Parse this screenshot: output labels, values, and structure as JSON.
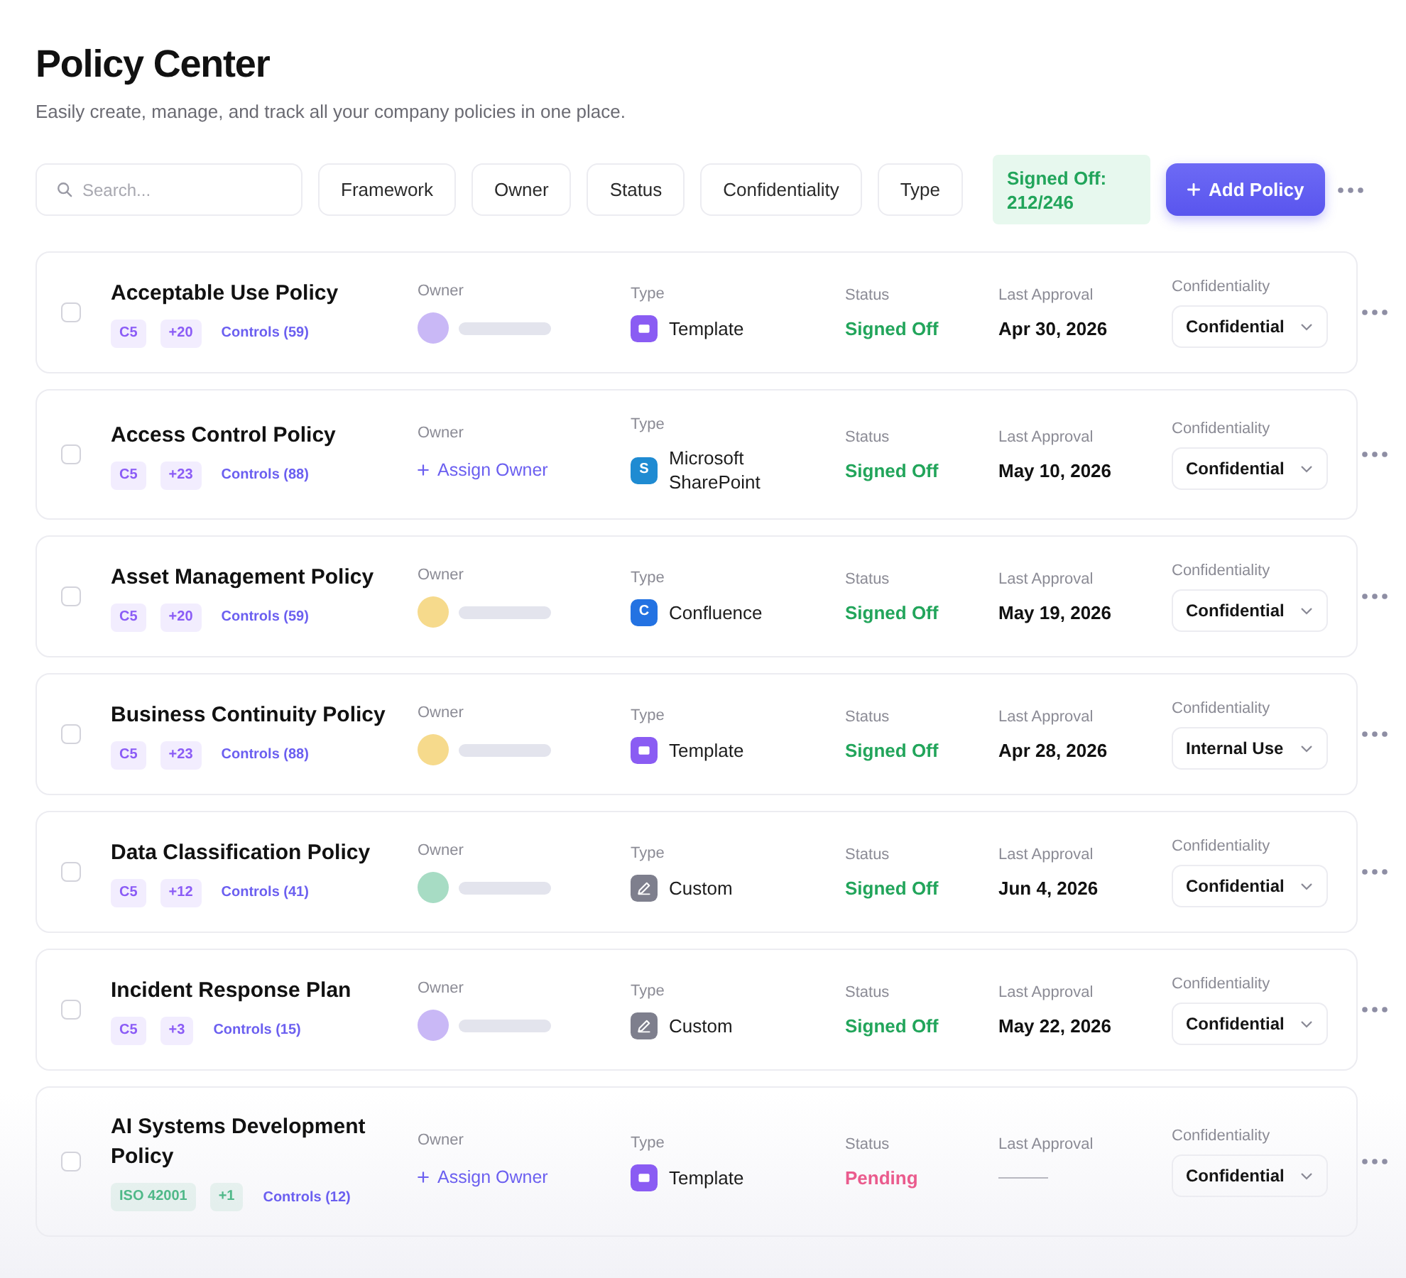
{
  "header": {
    "title": "Policy Center",
    "subtitle": "Easily create, manage, and track all your company policies in one place."
  },
  "toolbar": {
    "search": {
      "placeholder": "Search..."
    },
    "filters": [
      "Framework",
      "Owner",
      "Status",
      "Confidentiality",
      "Type"
    ],
    "summary": {
      "label": "Signed Off:",
      "value": "212/246"
    },
    "add_button": "Add Policy"
  },
  "policies": [
    {
      "name": "Acceptable Use Policy",
      "checked": false,
      "tags": [
        {
          "label": "C5",
          "color": "#8b5cf6"
        },
        {
          "label": "+20",
          "color": "#8b5cf6"
        }
      ],
      "controls": "Controls (59)",
      "owner_label": "Owner",
      "owner": {
        "kind": "avatar",
        "color": "#c9b8f6"
      },
      "type_label": "Type",
      "type": {
        "kind": "template",
        "label": "Template"
      },
      "status_label": "Status",
      "status": {
        "kind": "signed_off",
        "label": "Signed Off"
      },
      "approval_label": "Last Approval",
      "approval": {
        "kind": "date",
        "text": "Apr 30, 2026"
      },
      "confidentiality_label": "Confidentiality",
      "confidentiality": "Confidential"
    },
    {
      "name": "Access Control Policy",
      "checked": false,
      "tags": [
        {
          "label": "C5",
          "color": "#8b5cf6"
        },
        {
          "label": "+23",
          "color": "#8b5cf6"
        }
      ],
      "controls": "Controls (88)",
      "owner_label": "Owner",
      "owner": {
        "kind": "assign",
        "label": "Assign Owner"
      },
      "type_label": "Type",
      "type": {
        "kind": "sharepoint",
        "icon_text": "S",
        "label": "Microsoft SharePoint"
      },
      "status_label": "Status",
      "status": {
        "kind": "signed_off",
        "label": "Signed Off"
      },
      "approval_label": "Last Approval",
      "approval": {
        "kind": "date",
        "text": "May 10, 2026"
      },
      "confidentiality_label": "Confidentiality",
      "confidentiality": "Confidential"
    },
    {
      "name": "Asset Management Policy",
      "checked": false,
      "tags": [
        {
          "label": "C5",
          "color": "#8b5cf6"
        },
        {
          "label": "+20",
          "color": "#8b5cf6"
        }
      ],
      "controls": "Controls (59)",
      "owner_label": "Owner",
      "owner": {
        "kind": "avatar",
        "color": "#f6da8c"
      },
      "type_label": "Type",
      "type": {
        "kind": "confluence",
        "icon_text": "C",
        "label": "Confluence"
      },
      "status_label": "Status",
      "status": {
        "kind": "signed_off",
        "label": "Signed Off"
      },
      "approval_label": "Last Approval",
      "approval": {
        "kind": "date",
        "text": "May 19, 2026"
      },
      "confidentiality_label": "Confidentiality",
      "confidentiality": "Confidential"
    },
    {
      "name": "Business Continuity Policy",
      "checked": false,
      "tags": [
        {
          "label": "C5",
          "color": "#8b5cf6"
        },
        {
          "label": "+23",
          "color": "#8b5cf6"
        }
      ],
      "controls": "Controls (88)",
      "owner_label": "Owner",
      "owner": {
        "kind": "avatar",
        "color": "#f6da8c"
      },
      "type_label": "Type",
      "type": {
        "kind": "template",
        "label": "Template"
      },
      "status_label": "Status",
      "status": {
        "kind": "signed_off",
        "label": "Signed Off"
      },
      "approval_label": "Last Approval",
      "approval": {
        "kind": "date",
        "text": "Apr 28, 2026"
      },
      "confidentiality_label": "Confidentiality",
      "confidentiality": "Internal Use"
    },
    {
      "name": "Data Classification Policy",
      "checked": false,
      "tags": [
        {
          "label": "C5",
          "color": "#8b5cf6"
        },
        {
          "label": "+12",
          "color": "#8b5cf6"
        }
      ],
      "controls": "Controls (41)",
      "owner_label": "Owner",
      "owner": {
        "kind": "avatar",
        "color": "#a7dcc4"
      },
      "type_label": "Type",
      "type": {
        "kind": "custom",
        "label": "Custom"
      },
      "status_label": "Status",
      "status": {
        "kind": "signed_off",
        "label": "Signed Off"
      },
      "approval_label": "Last Approval",
      "approval": {
        "kind": "date",
        "text": "Jun 4, 2026"
      },
      "confidentiality_label": "Confidentiality",
      "confidentiality": "Confidential"
    },
    {
      "name": "Incident Response Plan",
      "checked": false,
      "tags": [
        {
          "label": "C5",
          "color": "#8b5cf6"
        },
        {
          "label": "+3",
          "color": "#8b5cf6"
        }
      ],
      "controls": "Controls (15)",
      "owner_label": "Owner",
      "owner": {
        "kind": "avatar",
        "color": "#c9b8f6"
      },
      "type_label": "Type",
      "type": {
        "kind": "custom",
        "label": "Custom"
      },
      "status_label": "Status",
      "status": {
        "kind": "signed_off",
        "label": "Signed Off"
      },
      "approval_label": "Last Approval",
      "approval": {
        "kind": "date",
        "text": "May 22, 2026"
      },
      "confidentiality_label": "Confidentiality",
      "confidentiality": "Confidential"
    },
    {
      "name": "AI Systems Development Policy",
      "checked": false,
      "tags": [
        {
          "label": "ISO 42001",
          "color": "#4fb888"
        },
        {
          "label": "+1",
          "color": "#4fb888"
        }
      ],
      "controls": "Controls (12)",
      "owner_label": "Owner",
      "owner": {
        "kind": "assign",
        "label": "Assign Owner"
      },
      "type_label": "Type",
      "type": {
        "kind": "template",
        "label": "Template"
      },
      "status_label": "Status",
      "status": {
        "kind": "pending",
        "label": "Pending"
      },
      "approval_label": "Last Approval",
      "approval": {
        "kind": "none"
      },
      "confidentiality_label": "Confidentiality",
      "confidentiality": "Confidential"
    }
  ]
}
